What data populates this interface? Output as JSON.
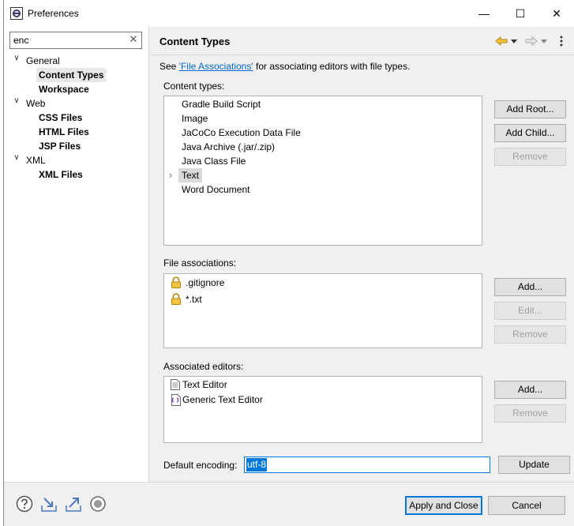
{
  "window": {
    "title": "Preferences",
    "minimize_glyph": "—",
    "maximize_glyph": "☐",
    "close_glyph": "✕"
  },
  "filter": {
    "value": "enc",
    "clear_glyph": "✕"
  },
  "tree": [
    {
      "label": "General",
      "expanded": true,
      "children": [
        "Content Types",
        "Workspace"
      ]
    },
    {
      "label": "Web",
      "expanded": true,
      "children": [
        "CSS Files",
        "HTML Files",
        "JSP Files"
      ]
    },
    {
      "label": "XML",
      "expanded": true,
      "children": [
        "XML Files"
      ]
    }
  ],
  "tree_twisty_glyph": "∨",
  "page": {
    "title": "Content Types",
    "see_prefix": "See ",
    "see_link": "'File Associations'",
    "see_suffix": " for associating editors with file types."
  },
  "content_types": {
    "label": "Content types:",
    "items": [
      "Gradle Build Script",
      "Image",
      "JaCoCo Execution Data File",
      "Java Archive (.jar/.zip)",
      "Java Class File",
      "Text",
      "Word Document"
    ],
    "selected": "Text",
    "expand_glyph": "›",
    "buttons": {
      "add_root": "Add Root...",
      "add_child": "Add Child...",
      "remove": "Remove"
    }
  },
  "file_associations": {
    "label": "File associations:",
    "items": [
      ".gitignore",
      "*.txt"
    ],
    "buttons": {
      "add": "Add...",
      "edit": "Edit...",
      "remove": "Remove"
    }
  },
  "associated_editors": {
    "label": "Associated editors:",
    "items": [
      "Text Editor",
      "Generic Text Editor"
    ],
    "buttons": {
      "add": "Add...",
      "remove": "Remove"
    }
  },
  "encoding": {
    "label": "Default encoding:",
    "value": "utf-8",
    "update": "Update"
  },
  "footer": {
    "apply_close": "Apply and Close",
    "cancel": "Cancel"
  },
  "colors": {
    "selection": "#0078d7",
    "link": "#0066cc",
    "lock": "#e0a800"
  }
}
